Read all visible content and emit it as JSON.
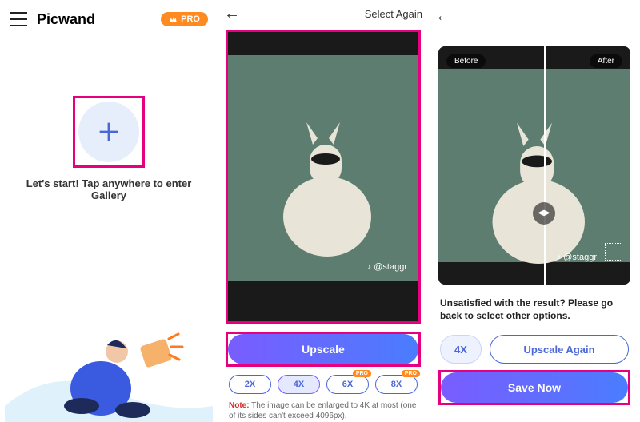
{
  "panel1": {
    "app_title": "Picwand",
    "pro_label": "PRO",
    "start_text": "Let's start! Tap anywhere to enter Gallery"
  },
  "panel2": {
    "select_again": "Select Again",
    "watermark": "♪ @staggr",
    "upscale_btn": "Upscale",
    "scales": {
      "s2": "2X",
      "s4": "4X",
      "s6": "6X",
      "s8": "8X"
    },
    "pro_tag": "PRO",
    "note_label": "Note:",
    "note_text": " The image can be enlarged to 4K at most (one of its sides can't exceed 4096px)."
  },
  "panel3": {
    "before": "Before",
    "after": "After",
    "watermark": "♪ @staggr",
    "unsatisfied": "Unsatisfied with the result? Please go back to select other options.",
    "scale4x": "4X",
    "upscale_again": "Upscale Again",
    "save_now": "Save Now"
  }
}
